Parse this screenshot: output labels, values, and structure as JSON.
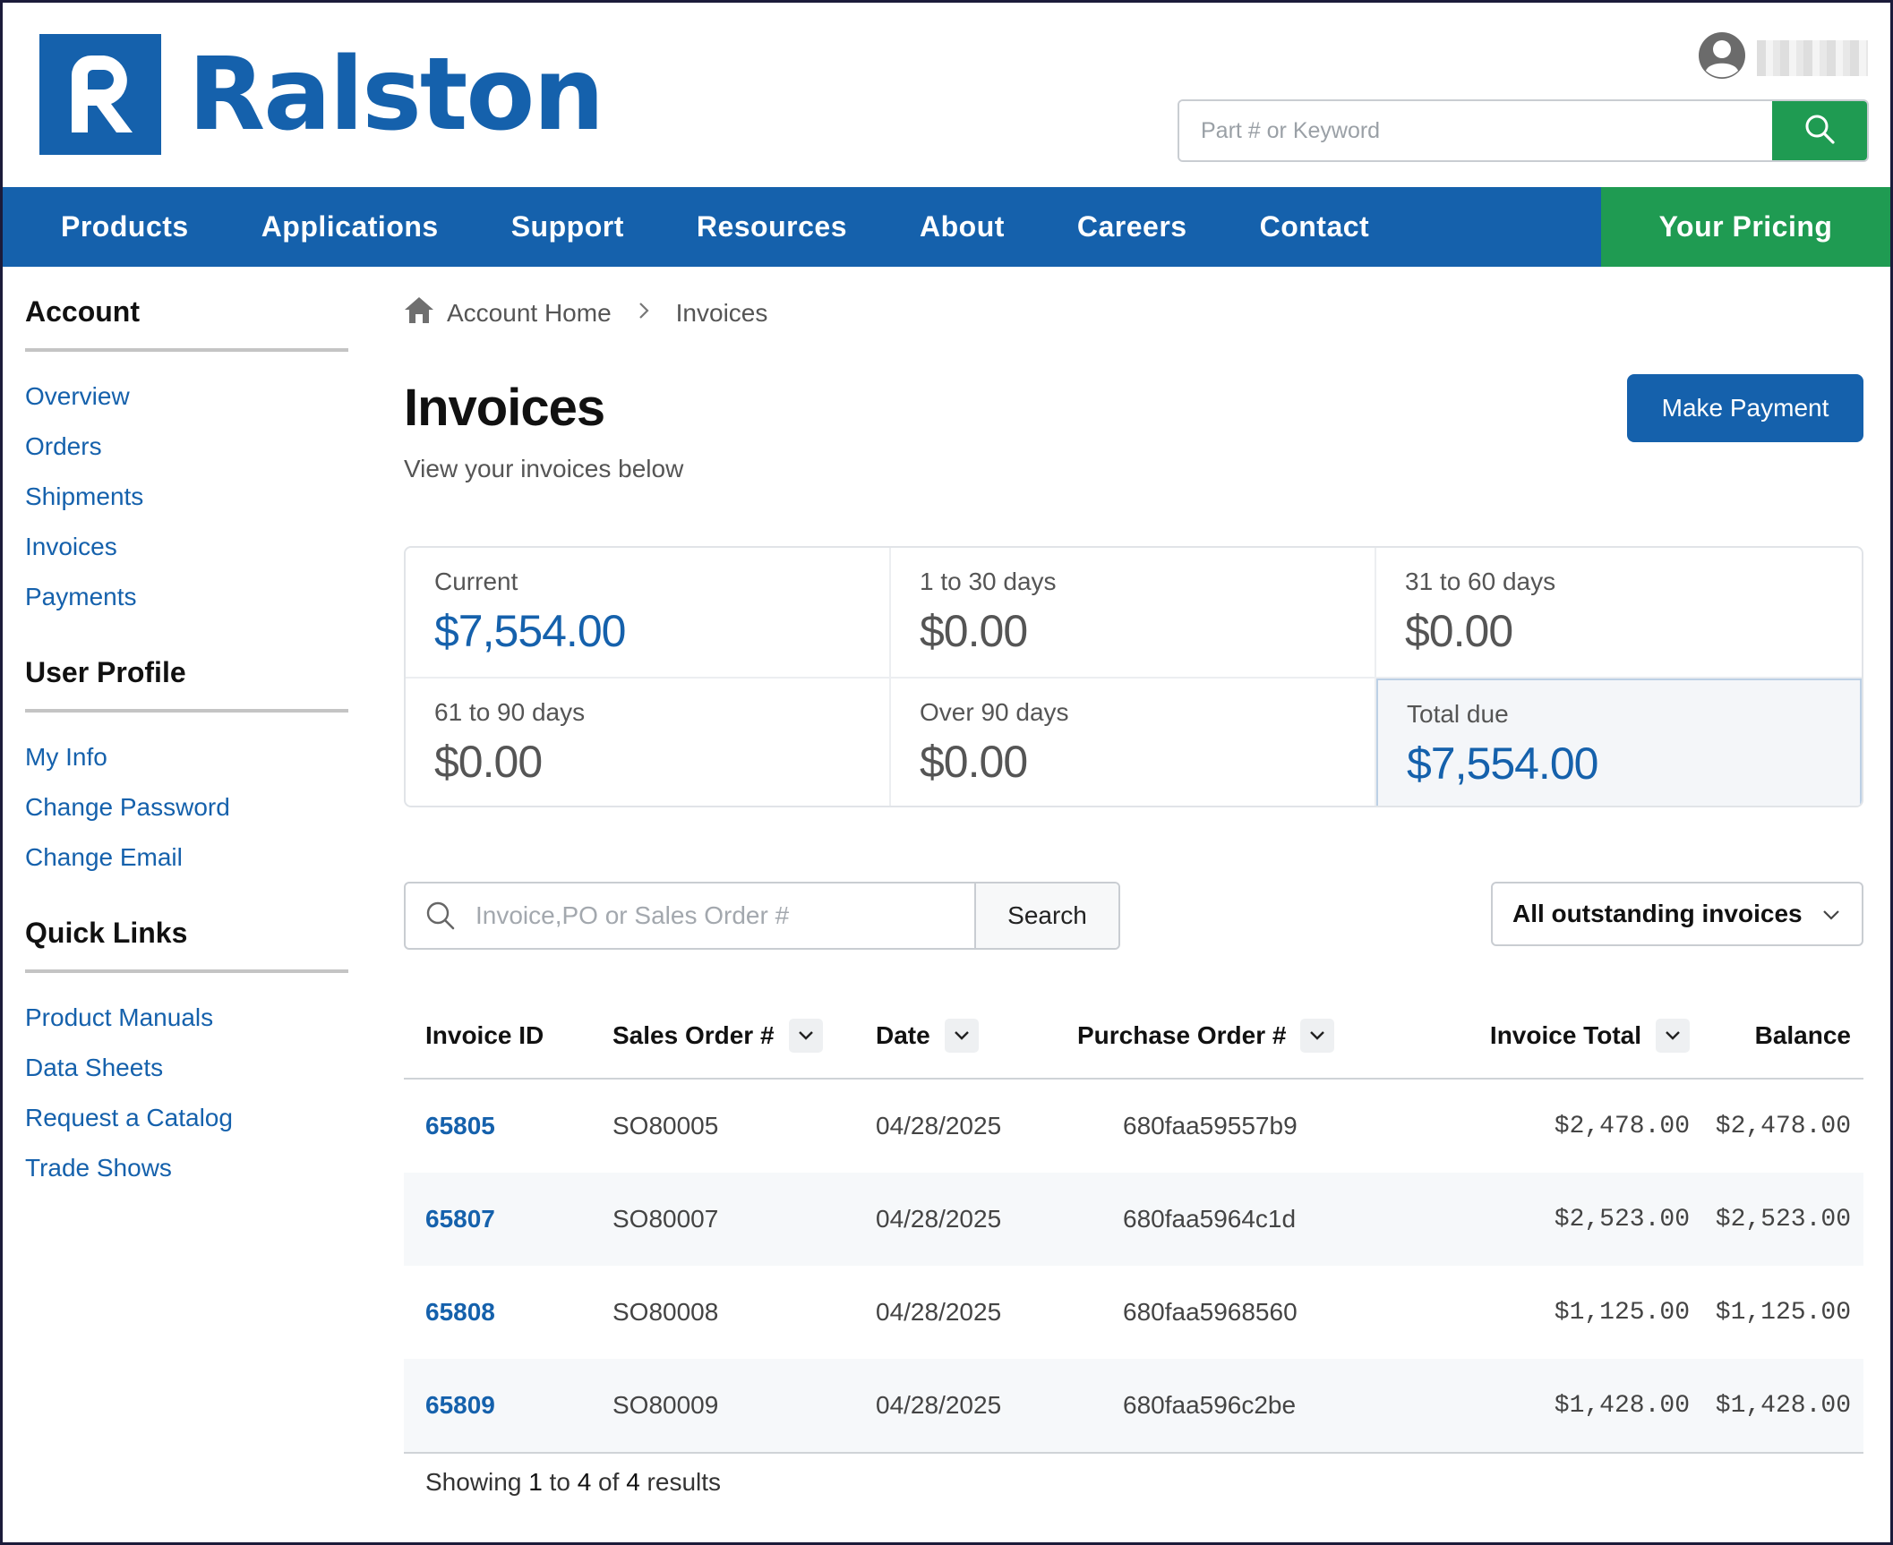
{
  "brand": {
    "name": "Ralston",
    "color": "#1561ac",
    "accent_green": "#1f9b52"
  },
  "header": {
    "search_placeholder": "Part # or Keyword",
    "user_icon": "user-circle-icon",
    "search_icon": "search-icon"
  },
  "nav": {
    "items": [
      "Products",
      "Applications",
      "Support",
      "Resources",
      "About",
      "Careers",
      "Contact"
    ],
    "pricing": "Your Pricing"
  },
  "sidebar": {
    "sections": [
      {
        "title": "Account",
        "links": [
          "Overview",
          "Orders",
          "Shipments",
          "Invoices",
          "Payments"
        ]
      },
      {
        "title": "User Profile",
        "links": [
          "My Info",
          "Change Password",
          "Change Email"
        ]
      },
      {
        "title": "Quick Links",
        "links": [
          "Product Manuals",
          "Data Sheets",
          "Request a Catalog",
          "Trade Shows"
        ]
      }
    ]
  },
  "breadcrumb": {
    "home": "Account Home",
    "current": "Invoices"
  },
  "page": {
    "title": "Invoices",
    "subtitle": "View your invoices below",
    "make_payment": "Make Payment"
  },
  "aging": [
    {
      "label": "Current",
      "value": "$7,554.00",
      "highlight": true
    },
    {
      "label": "1 to 30 days",
      "value": "$0.00",
      "highlight": false
    },
    {
      "label": "31 to 60 days",
      "value": "$0.00",
      "highlight": false
    },
    {
      "label": "61 to 90 days",
      "value": "$0.00",
      "highlight": false
    },
    {
      "label": "Over 90 days",
      "value": "$0.00",
      "highlight": false
    },
    {
      "label": "Total due",
      "value": "$7,554.00",
      "highlight": true
    }
  ],
  "filters": {
    "search_placeholder": "Invoice,PO or Sales Order #",
    "search_button": "Search",
    "status_selected": "All outstanding invoices"
  },
  "table": {
    "headers": {
      "invoice_id": "Invoice ID",
      "sales_order": "Sales Order #",
      "date": "Date",
      "purchase_order": "Purchase Order #",
      "invoice_total": "Invoice Total",
      "balance": "Balance"
    },
    "rows": [
      {
        "id": "65805",
        "so": "SO80005",
        "date": "04/28/2025",
        "po": "680faa59557b9",
        "total": "$2,478.00",
        "balance": "$2,478.00"
      },
      {
        "id": "65807",
        "so": "SO80007",
        "date": "04/28/2025",
        "po": "680faa5964c1d",
        "total": "$2,523.00",
        "balance": "$2,523.00"
      },
      {
        "id": "65808",
        "so": "SO80008",
        "date": "04/28/2025",
        "po": "680faa5968560",
        "total": "$1,125.00",
        "balance": "$1,125.00"
      },
      {
        "id": "65809",
        "so": "SO80009",
        "date": "04/28/2025",
        "po": "680faa596c2be",
        "total": "$1,428.00",
        "balance": "$1,428.00"
      }
    ]
  },
  "results": {
    "prefix": "Showing",
    "from": "1",
    "to_word": "to",
    "to": "4",
    "of_word": "of",
    "total": "4",
    "suffix": "results"
  }
}
